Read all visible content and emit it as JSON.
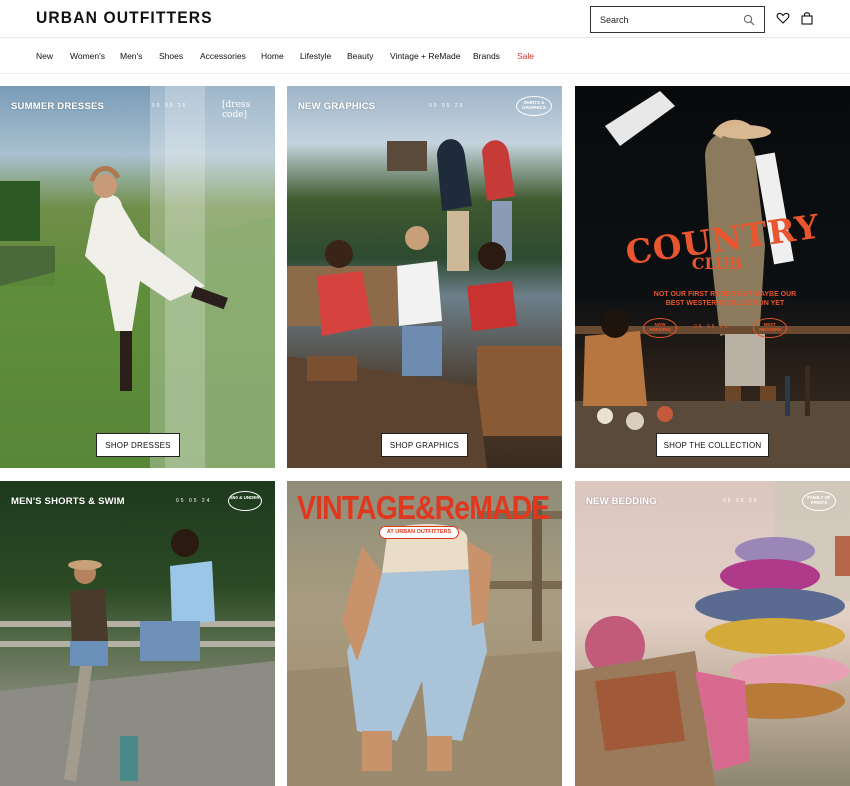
{
  "header": {
    "logo": "URBAN OUTFITTERS",
    "search_placeholder": "Search"
  },
  "nav": {
    "items": [
      {
        "label": "New"
      },
      {
        "label": "Women's"
      },
      {
        "label": "Men's"
      },
      {
        "label": "Shoes"
      },
      {
        "label": "Accessories"
      },
      {
        "label": "Home"
      },
      {
        "label": "Lifestyle"
      },
      {
        "label": "Beauty"
      },
      {
        "label": "Vintage + ReMade"
      },
      {
        "label": "Brands"
      },
      {
        "label": "Sale"
      }
    ]
  },
  "tiles": [
    {
      "title": "SUMMER DRESSES",
      "date": "05 05 25",
      "tag": "[dress code]",
      "cta": "SHOP DRESSES"
    },
    {
      "title": "NEW GRAPHICS",
      "date": "05 05 25",
      "badge": "SHIRTS & GRAPHICS",
      "cta": "SHOP GRAPHICS"
    },
    {
      "headline": "COUNTRY",
      "subheadline": "CLUB",
      "text": "NOT OUR FIRST RODEO BUT MAYBE OUR BEST WESTERN COLLECTION YET",
      "date": "05 05 25",
      "badge_left": "NOW ARRIVING",
      "badge_right": "BEST WESTERN",
      "cta": "SHOP THE COLLECTION"
    },
    {
      "title": "MEN'S SHORTS & SWIM",
      "date": "05 05 24",
      "badge": "$50 & UNDER"
    },
    {
      "headline": "VINTAGE&ReMADE",
      "subheadline": "AT URBAN OUTFITTERS"
    },
    {
      "title": "NEW BEDDING",
      "date": "05 05 25",
      "badge": "FAMILY OF PRINTS"
    }
  ],
  "colors": {
    "sale": "#d0332b",
    "vintage_red": "#e2371f",
    "country_orange": "#e8552f"
  }
}
